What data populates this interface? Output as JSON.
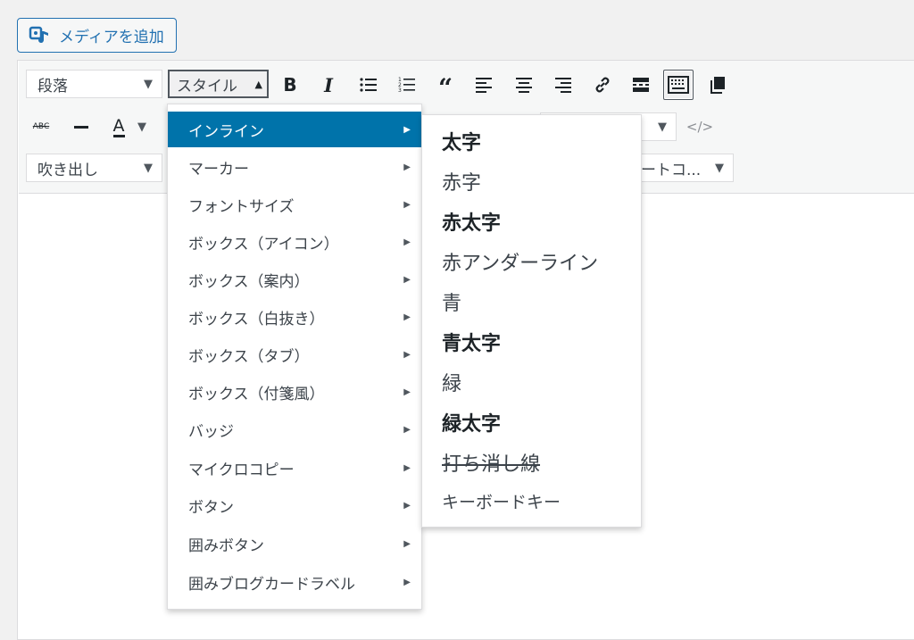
{
  "media_button": {
    "label": "メディアを追加",
    "icon": "media-add-icon"
  },
  "toolbar": {
    "format_select": "段落",
    "style_select": "スタイル",
    "balloon_select": "吹き出し",
    "shortcode_select": "ートコ...",
    "buttons_row1": [
      "bold-icon",
      "italic-icon",
      "bullet-list-icon",
      "numbered-list-icon",
      "blockquote-icon",
      "align-left-icon",
      "align-center-icon",
      "align-right-icon",
      "link-icon",
      "read-more-icon",
      "toolbar-toggle-icon",
      "copy-icon"
    ],
    "buttons_row2": [
      "strikethrough-icon",
      "horizontal-rule-icon",
      "text-color-icon",
      "code-icon"
    ],
    "strike_label": "ABC",
    "text_color_label": "A",
    "text_color": "#1d2327"
  },
  "style_menu": {
    "items": [
      "インライン",
      "マーカー",
      "フォントサイズ",
      "ボックス（アイコン）",
      "ボックス（案内）",
      "ボックス（白抜き）",
      "ボックス（タブ）",
      "ボックス（付箋風）",
      "バッジ",
      "マイクロコピー",
      "ボタン",
      "囲みボタン",
      "囲みブログカードラベル"
    ],
    "active_index": 0
  },
  "inline_submenu": {
    "items": [
      "太字",
      "赤字",
      "赤太字",
      "赤アンダーライン",
      "青",
      "青太字",
      "緑",
      "緑太字",
      "打ち消し線",
      "キーボードキー"
    ]
  },
  "colors": {
    "accent": "#0073aa",
    "link": "#2271b1"
  }
}
